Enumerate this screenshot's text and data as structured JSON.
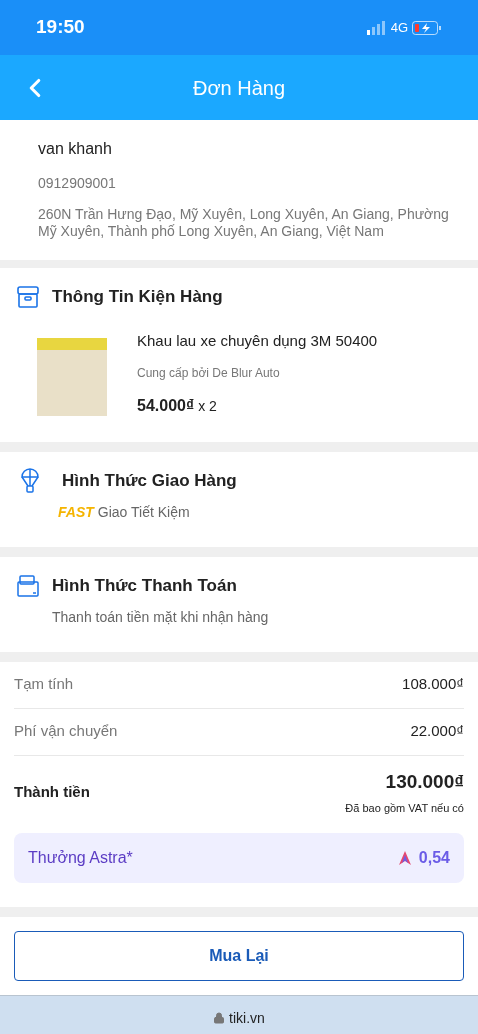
{
  "status_bar": {
    "time": "19:50",
    "network": "4G"
  },
  "header": {
    "title": "Đơn Hàng"
  },
  "recipient": {
    "name": "van khanh",
    "phone": "0912909001",
    "address": "260N Trần Hưng Đạo, Mỹ Xuyên, Long Xuyên, An Giang, Phường Mỹ Xuyên, Thành phố Long Xuyên, An Giang, Việt Nam"
  },
  "package": {
    "heading": "Thông Tin Kiện Hàng",
    "product": {
      "name": "Khau lau xe chuyên dụng 3M 50400",
      "seller": "Cung cấp bởi De Blur Auto",
      "price": "54.000₫",
      "quantity": "x 2"
    }
  },
  "shipping": {
    "heading": "Hình Thức Giao Hàng",
    "badge": "FAST",
    "method": "Giao Tiết Kiệm"
  },
  "payment": {
    "heading": "Hình Thức Thanh Toán",
    "method": "Thanh toán tiền mặt khi nhận hàng"
  },
  "summary": {
    "rows": [
      {
        "label": "Tạm tính",
        "value": "108.000₫"
      },
      {
        "label": "Phí vận chuyển",
        "value": "22.000₫"
      }
    ],
    "total_label": "Thành tiền",
    "total_value": "130.000₫",
    "vat_note": "Đã bao gồm VAT nếu có",
    "reward_label": "Thưởng Astra*",
    "reward_value": "0,54"
  },
  "action_button": "Mua Lại",
  "browser_bar": {
    "url": "tiki.vn"
  }
}
